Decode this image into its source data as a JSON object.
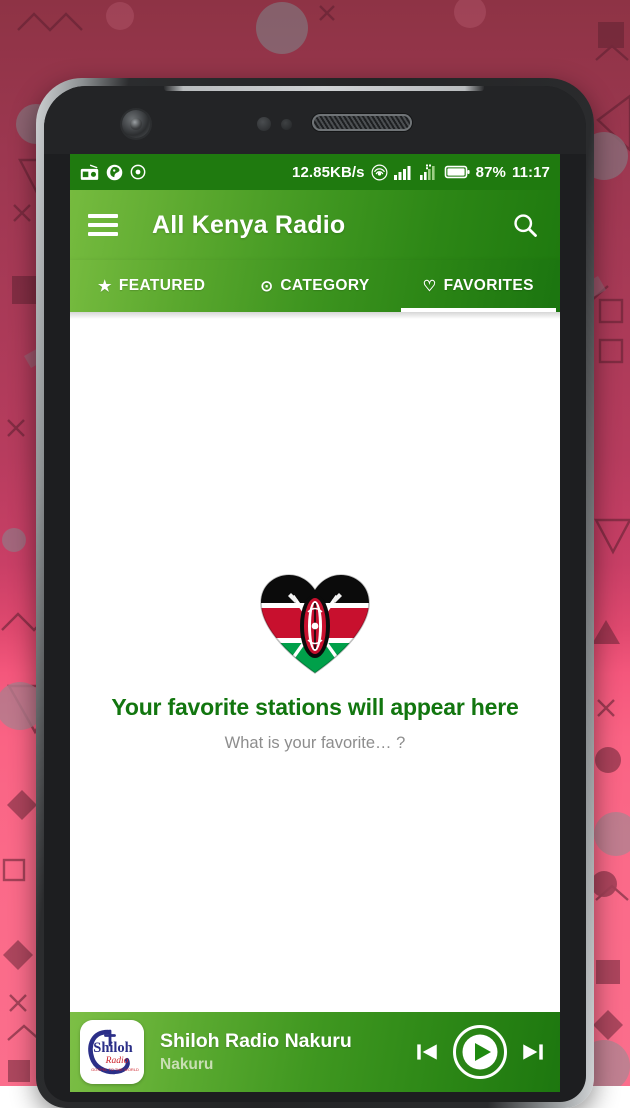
{
  "statusbar": {
    "notification_icons": [
      "radio-icon",
      "sync-fan-icon",
      "record-target-icon"
    ],
    "network_speed": "12.85KB/s",
    "hotspot_icon": "hotspot-icon",
    "signal_icon": "signal-bars-icon",
    "signal2_icon": "signal-bars-secondary-icon",
    "battery_icon": "battery-icon",
    "battery_percent": "87%",
    "clock": "11:17"
  },
  "appbar": {
    "menu_icon": "hamburger-menu-icon",
    "title": "All Kenya Radio",
    "search_icon": "search-icon",
    "gradient_from": "#76bb3f",
    "gradient_to": "#1f7a0f"
  },
  "tabs": [
    {
      "glyph": "★",
      "icon_name": "star-icon",
      "label": "FEATURED",
      "active": false
    },
    {
      "glyph": "⊙",
      "icon_name": "category-target-icon",
      "label": "CATEGORY",
      "active": false
    },
    {
      "glyph": "♡",
      "icon_name": "heart-outline-icon",
      "label": "FAVORITES",
      "active": true
    }
  ],
  "content": {
    "illustration": "kenya-flag-heart-icon",
    "empty_title": "Your favorite stations will appear here",
    "empty_subtitle": "What is your favorite… ?",
    "title_color": "#12760f",
    "subtitle_color": "#8d8d8d"
  },
  "player": {
    "album_art": "shiloh-radio-logo",
    "logo_text_main": "Shiloh",
    "logo_text_sub": "Radio",
    "logo_tagline": "GOSPEL TO THE WORLD",
    "track_title": "Shiloh Radio Nakuru",
    "track_subtitle": "Nakuru",
    "previous_icon": "skip-previous-icon",
    "play_icon": "play-circle-icon",
    "next_icon": "skip-next-icon"
  },
  "background": {
    "top_color": "#8e3345",
    "bottom_color": "#fb6e8c",
    "style": "memphis-shapes-pattern"
  }
}
